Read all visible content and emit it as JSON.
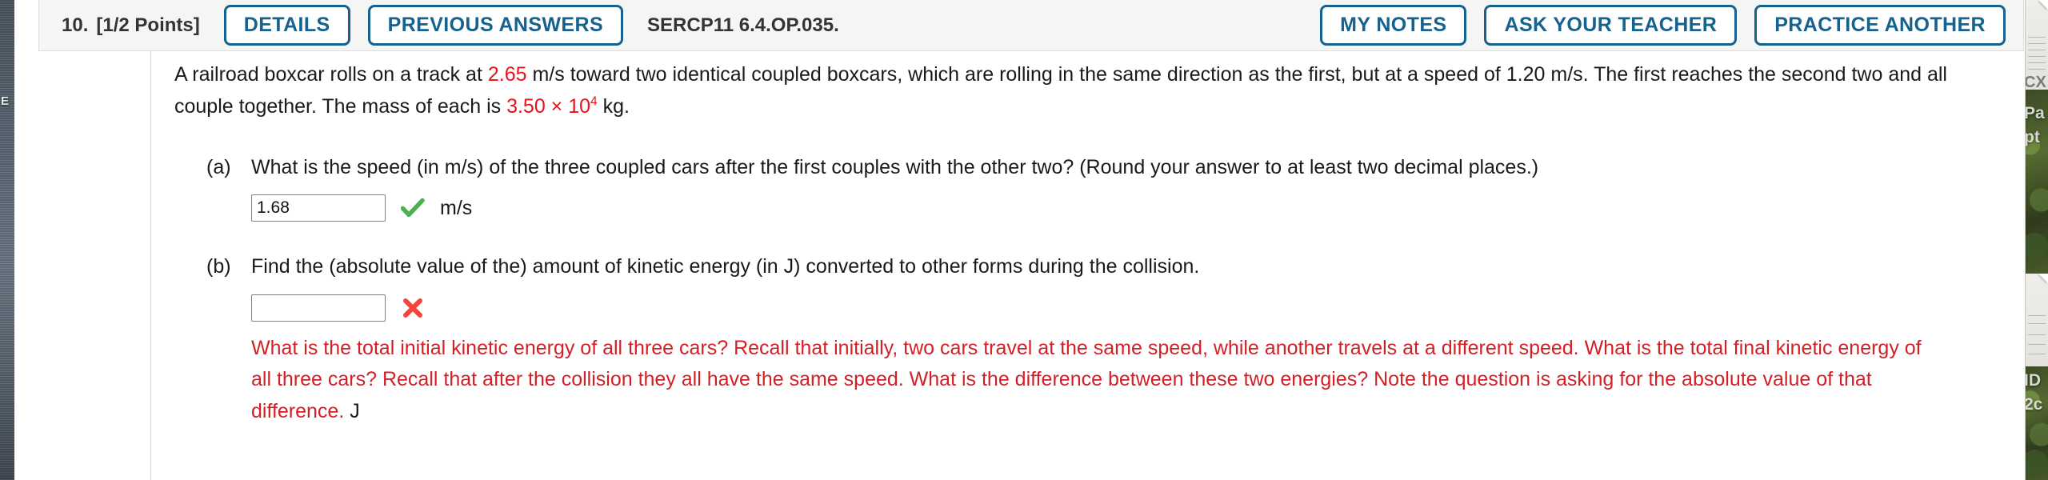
{
  "desktop": {
    "left_label": "E",
    "right_items": [
      {
        "type": "doc-thumb",
        "caption": "CX"
      },
      {
        "type": "photo",
        "caption_line1": "Pa",
        "caption_line2": "pt"
      },
      {
        "type": "doc-thumb",
        "caption": ""
      },
      {
        "type": "photo",
        "caption_line1": "ID",
        "caption_line2": "2c"
      }
    ]
  },
  "header": {
    "question_number": "10.",
    "points": "[1/2 Points]",
    "question_code": "SERCP11 6.4.OP.035.",
    "buttons": [
      {
        "label": "DETAILS",
        "name": "details-button"
      },
      {
        "label": "PREVIOUS ANSWERS",
        "name": "previous-answers-button"
      }
    ],
    "right_buttons": [
      {
        "label": "MY NOTES",
        "name": "my-notes-button"
      },
      {
        "label": "ASK YOUR TEACHER",
        "name": "ask-your-teacher-button"
      },
      {
        "label": "PRACTICE ANOTHER",
        "name": "practice-another-button"
      }
    ],
    "accent_color": "#15628f",
    "background_color": "#f5f5f5"
  },
  "question": {
    "stem_part1": "A railroad boxcar rolls on a track at ",
    "stem_value1": "2.65",
    "stem_part2": " m/s toward two identical coupled boxcars, which are rolling in the same direction as the first, but at a speed of 1.20 m/s. The first reaches the second two and all couple together. The mass of each is ",
    "stem_value2_mantissa": "3.50 × 10",
    "stem_value2_exponent": "4",
    "stem_part3": " kg.",
    "highlight_color": "#e8121b"
  },
  "parts": [
    {
      "label": "(a)",
      "text": "What is the speed (in m/s) of the three coupled cars after the first couples with the other two? (Round your answer to at least two decimal places.)",
      "answer_value": "1.68",
      "answer_placeholder": "",
      "mark": "correct",
      "mark_color": "#4caf50",
      "unit": "m/s",
      "feedback": ""
    },
    {
      "label": "(b)",
      "text": "Find the (absolute value of the) amount of kinetic energy (in J) converted to other forms during the collision.",
      "answer_value": "",
      "answer_placeholder": "",
      "mark": "incorrect",
      "mark_color": "#f4453c",
      "unit": "",
      "feedback": "What is the total initial kinetic energy of all three cars? Recall that initially, two cars travel at the same speed, while another travels at a different speed. What is the total final kinetic energy of all three cars? Recall that after the collision they all have the same speed. What is the difference between these two energies? Note the question is asking for the absolute value of that difference.",
      "feedback_unit": "J",
      "feedback_color": "#d31f26"
    }
  ]
}
